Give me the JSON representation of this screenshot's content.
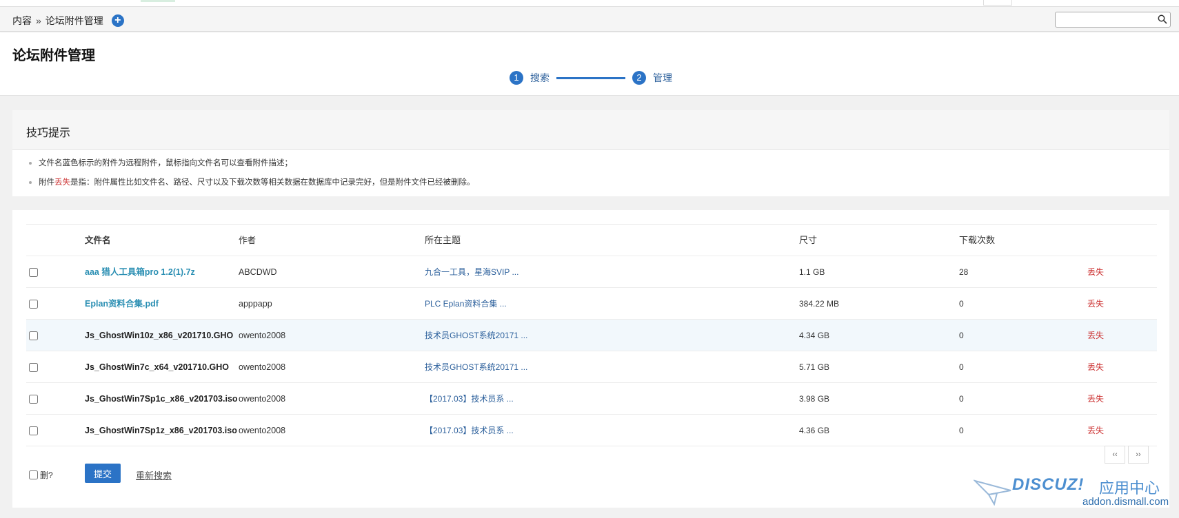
{
  "breadcrumb": {
    "root": "内容",
    "separator": "»",
    "current": "论坛附件管理"
  },
  "search": {
    "placeholder": ""
  },
  "header": {
    "title": "论坛附件管理"
  },
  "steps": [
    {
      "num": "1",
      "label": "搜索"
    },
    {
      "num": "2",
      "label": "管理"
    }
  ],
  "tips": {
    "title": "技巧提示",
    "line1": "文件名蓝色标示的附件为远程附件，鼠标指向文件名可以查看附件描述；",
    "line2_prefix": "附件",
    "line2_red": "丢失",
    "line2_suffix": "是指：附件属性比如文件名、路径、尺寸以及下载次数等相关数据在数据库中记录完好，但是附件文件已经被删除。"
  },
  "table": {
    "columns": [
      "文件名",
      "作者",
      "所在主题",
      "尺寸",
      "下载次数"
    ],
    "rows": [
      {
        "name": "aaa 猎人工具箱pro 1.2(1).7z",
        "author": "ABCDWD",
        "topic": "九合一工具，星海SVIP ...",
        "size": "1.1 GB",
        "downloads": "28",
        "status": "丢失"
      },
      {
        "name": "Eplan资料合集.pdf",
        "author": "apppapp",
        "topic": "PLC Eplan资料合集 ...",
        "size": "384.22 MB",
        "downloads": "0",
        "status": "丢失"
      },
      {
        "name": "Js_GhostWin10z_x86_v201710.GHO",
        "author": "owento2008",
        "topic": "技术员GHOST系统20171 ...",
        "size": "4.34 GB",
        "downloads": "0",
        "status": "丢失"
      },
      {
        "name": "Js_GhostWin7c_x64_v201710.GHO",
        "author": "owento2008",
        "topic": "技术员GHOST系统20171 ...",
        "size": "5.71 GB",
        "downloads": "0",
        "status": "丢失"
      },
      {
        "name": "Js_GhostWin7Sp1c_x86_v201703.iso",
        "author": "owento2008",
        "topic": "【2017.03】技术员系 ...",
        "size": "3.98 GB",
        "downloads": "0",
        "status": "丢失"
      },
      {
        "name": "Js_GhostWin7Sp1z_x86_v201703.iso",
        "author": "owento2008",
        "topic": "【2017.03】技术员系 ...",
        "size": "4.36 GB",
        "downloads": "0",
        "status": "丢失"
      }
    ]
  },
  "footer": {
    "delete_label": "删?",
    "submit_label": "提交",
    "research_label": "重新搜索",
    "prev": "‹‹",
    "next": "››"
  },
  "watermark": {
    "brand": "DISCUZ!",
    "brand_cn": "应用中心",
    "url": "addon.dismall.com"
  }
}
